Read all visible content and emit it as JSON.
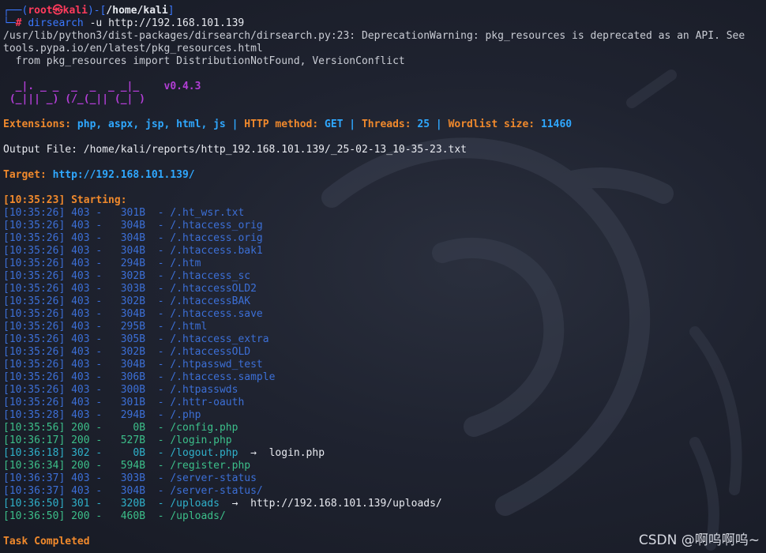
{
  "prompt": {
    "corner_top": "┌──(",
    "user": "root㉿kali",
    "mid": ")-[",
    "path": "/home/kali",
    "end": "]",
    "corner_bottom": "└─",
    "hash": "#",
    "cmd_name": "dirsearch",
    "cmd_args": "-u http://192.168.101.139"
  },
  "warnings": [
    "/usr/lib/python3/dist-packages/dirsearch/dirsearch.py:23: DeprecationWarning: pkg_resources is deprecated as an API. See",
    "tools.pypa.io/en/latest/pkg_resources.html",
    "  from pkg_resources import DistributionNotFound, VersionConflict"
  ],
  "banner": {
    "line1": "  _|. _ _  _  _  _ _|_    ",
    "version": "v0.4.3",
    "line2": " (_||| _) (/_(_|| (_| )"
  },
  "config": {
    "ext_label": "Extensions: ",
    "ext_value": "php, aspx, jsp, html, js",
    "sep": " | ",
    "method_label": "HTTP method: ",
    "method_value": "GET",
    "threads_label": "Threads: ",
    "threads_value": "25",
    "wordlist_label": "Wordlist size: ",
    "wordlist_value": "11460"
  },
  "output_file": "Output File: /home/kali/reports/http_192.168.101.139/_25-02-13_10-35-23.txt",
  "target": {
    "label": "Target: ",
    "url": "http://192.168.101.139/"
  },
  "starting": "[10:35:23] Starting: ",
  "results": [
    {
      "time": "[10:35:26]",
      "status": "403",
      "size": "  301B",
      "path": "/.ht_wsr.txt",
      "redirect": "",
      "cls": "s403"
    },
    {
      "time": "[10:35:26]",
      "status": "403",
      "size": "  304B",
      "path": "/.htaccess_orig",
      "redirect": "",
      "cls": "s403"
    },
    {
      "time": "[10:35:26]",
      "status": "403",
      "size": "  304B",
      "path": "/.htaccess.orig",
      "redirect": "",
      "cls": "s403"
    },
    {
      "time": "[10:35:26]",
      "status": "403",
      "size": "  304B",
      "path": "/.htaccess.bak1",
      "redirect": "",
      "cls": "s403"
    },
    {
      "time": "[10:35:26]",
      "status": "403",
      "size": "  294B",
      "path": "/.htm",
      "redirect": "",
      "cls": "s403"
    },
    {
      "time": "[10:35:26]",
      "status": "403",
      "size": "  302B",
      "path": "/.htaccess_sc",
      "redirect": "",
      "cls": "s403"
    },
    {
      "time": "[10:35:26]",
      "status": "403",
      "size": "  303B",
      "path": "/.htaccessOLD2",
      "redirect": "",
      "cls": "s403"
    },
    {
      "time": "[10:35:26]",
      "status": "403",
      "size": "  302B",
      "path": "/.htaccessBAK",
      "redirect": "",
      "cls": "s403"
    },
    {
      "time": "[10:35:26]",
      "status": "403",
      "size": "  304B",
      "path": "/.htaccess.save",
      "redirect": "",
      "cls": "s403"
    },
    {
      "time": "[10:35:26]",
      "status": "403",
      "size": "  295B",
      "path": "/.html",
      "redirect": "",
      "cls": "s403"
    },
    {
      "time": "[10:35:26]",
      "status": "403",
      "size": "  305B",
      "path": "/.htaccess_extra",
      "redirect": "",
      "cls": "s403"
    },
    {
      "time": "[10:35:26]",
      "status": "403",
      "size": "  302B",
      "path": "/.htaccessOLD",
      "redirect": "",
      "cls": "s403"
    },
    {
      "time": "[10:35:26]",
      "status": "403",
      "size": "  304B",
      "path": "/.htpasswd_test",
      "redirect": "",
      "cls": "s403"
    },
    {
      "time": "[10:35:26]",
      "status": "403",
      "size": "  306B",
      "path": "/.htaccess.sample",
      "redirect": "",
      "cls": "s403"
    },
    {
      "time": "[10:35:26]",
      "status": "403",
      "size": "  300B",
      "path": "/.htpasswds",
      "redirect": "",
      "cls": "s403"
    },
    {
      "time": "[10:35:26]",
      "status": "403",
      "size": "  301B",
      "path": "/.httr-oauth",
      "redirect": "",
      "cls": "s403"
    },
    {
      "time": "[10:35:28]",
      "status": "403",
      "size": "  294B",
      "path": "/.php",
      "redirect": "",
      "cls": "s403"
    },
    {
      "time": "[10:35:56]",
      "status": "200",
      "size": "    0B",
      "path": "/config.php",
      "redirect": "",
      "cls": "s200"
    },
    {
      "time": "[10:36:17]",
      "status": "200",
      "size": "  527B",
      "path": "/login.php",
      "redirect": "",
      "cls": "s200"
    },
    {
      "time": "[10:36:18]",
      "status": "302",
      "size": "    0B",
      "path": "/logout.php",
      "redirect": "login.php",
      "cls": "s30x"
    },
    {
      "time": "[10:36:34]",
      "status": "200",
      "size": "  594B",
      "path": "/register.php",
      "redirect": "",
      "cls": "s200"
    },
    {
      "time": "[10:36:37]",
      "status": "403",
      "size": "  303B",
      "path": "/server-status",
      "redirect": "",
      "cls": "s403"
    },
    {
      "time": "[10:36:37]",
      "status": "403",
      "size": "  304B",
      "path": "/server-status/",
      "redirect": "",
      "cls": "s403"
    },
    {
      "time": "[10:36:50]",
      "status": "301",
      "size": "  320B",
      "path": "/uploads",
      "redirect": "http://192.168.101.139/uploads/",
      "cls": "s30x"
    },
    {
      "time": "[10:36:50]",
      "status": "200",
      "size": "  460B",
      "path": "/uploads/",
      "redirect": "",
      "cls": "s200"
    }
  ],
  "completed": "Task Completed",
  "watermark": "CSDN @啊呜啊呜~",
  "colors": {
    "background": "#1f2330",
    "prompt_blue": "#3b78ff",
    "prompt_red": "#ff3b5c",
    "orange": "#f0892c",
    "cyan": "#2fa8ff",
    "purple": "#b23ed6",
    "status_403": "#3c6fd6",
    "status_200": "#3cbf8a",
    "status_30x": "#2fb0c9"
  }
}
